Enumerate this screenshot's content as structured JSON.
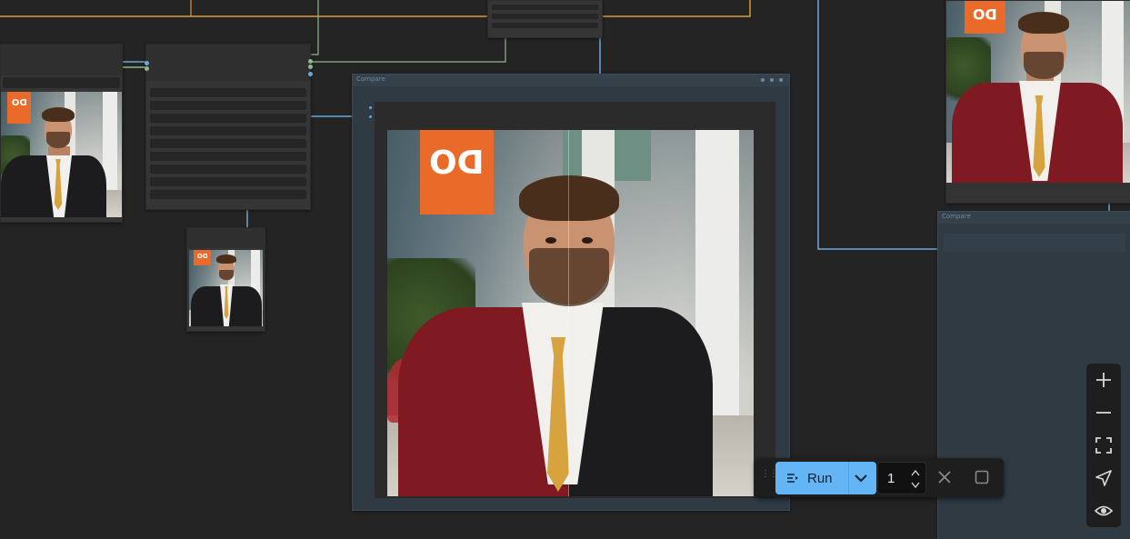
{
  "canvas": {
    "background": "#242424",
    "wire_blue": "#6aa8d8",
    "wire_orange": "#d99a3a",
    "wire_green": "#8fb98a"
  },
  "nodes": {
    "compare_main": {
      "title": "Compare"
    },
    "compare_right": {
      "title": "Compare"
    }
  },
  "banner_text": "DO",
  "toolbar": {
    "run_label": "Run",
    "batch_count": "1",
    "run_icon": "play-queue-icon",
    "dropdown_icon": "chevron-down-icon",
    "cancel_icon": "close-icon",
    "stop_icon": "stop-icon",
    "accent": "#64b5f6"
  },
  "zoom_controls": {
    "icons": [
      "plus-icon",
      "minus-icon",
      "fit-view-icon",
      "navigate-icon",
      "eye-icon"
    ]
  }
}
